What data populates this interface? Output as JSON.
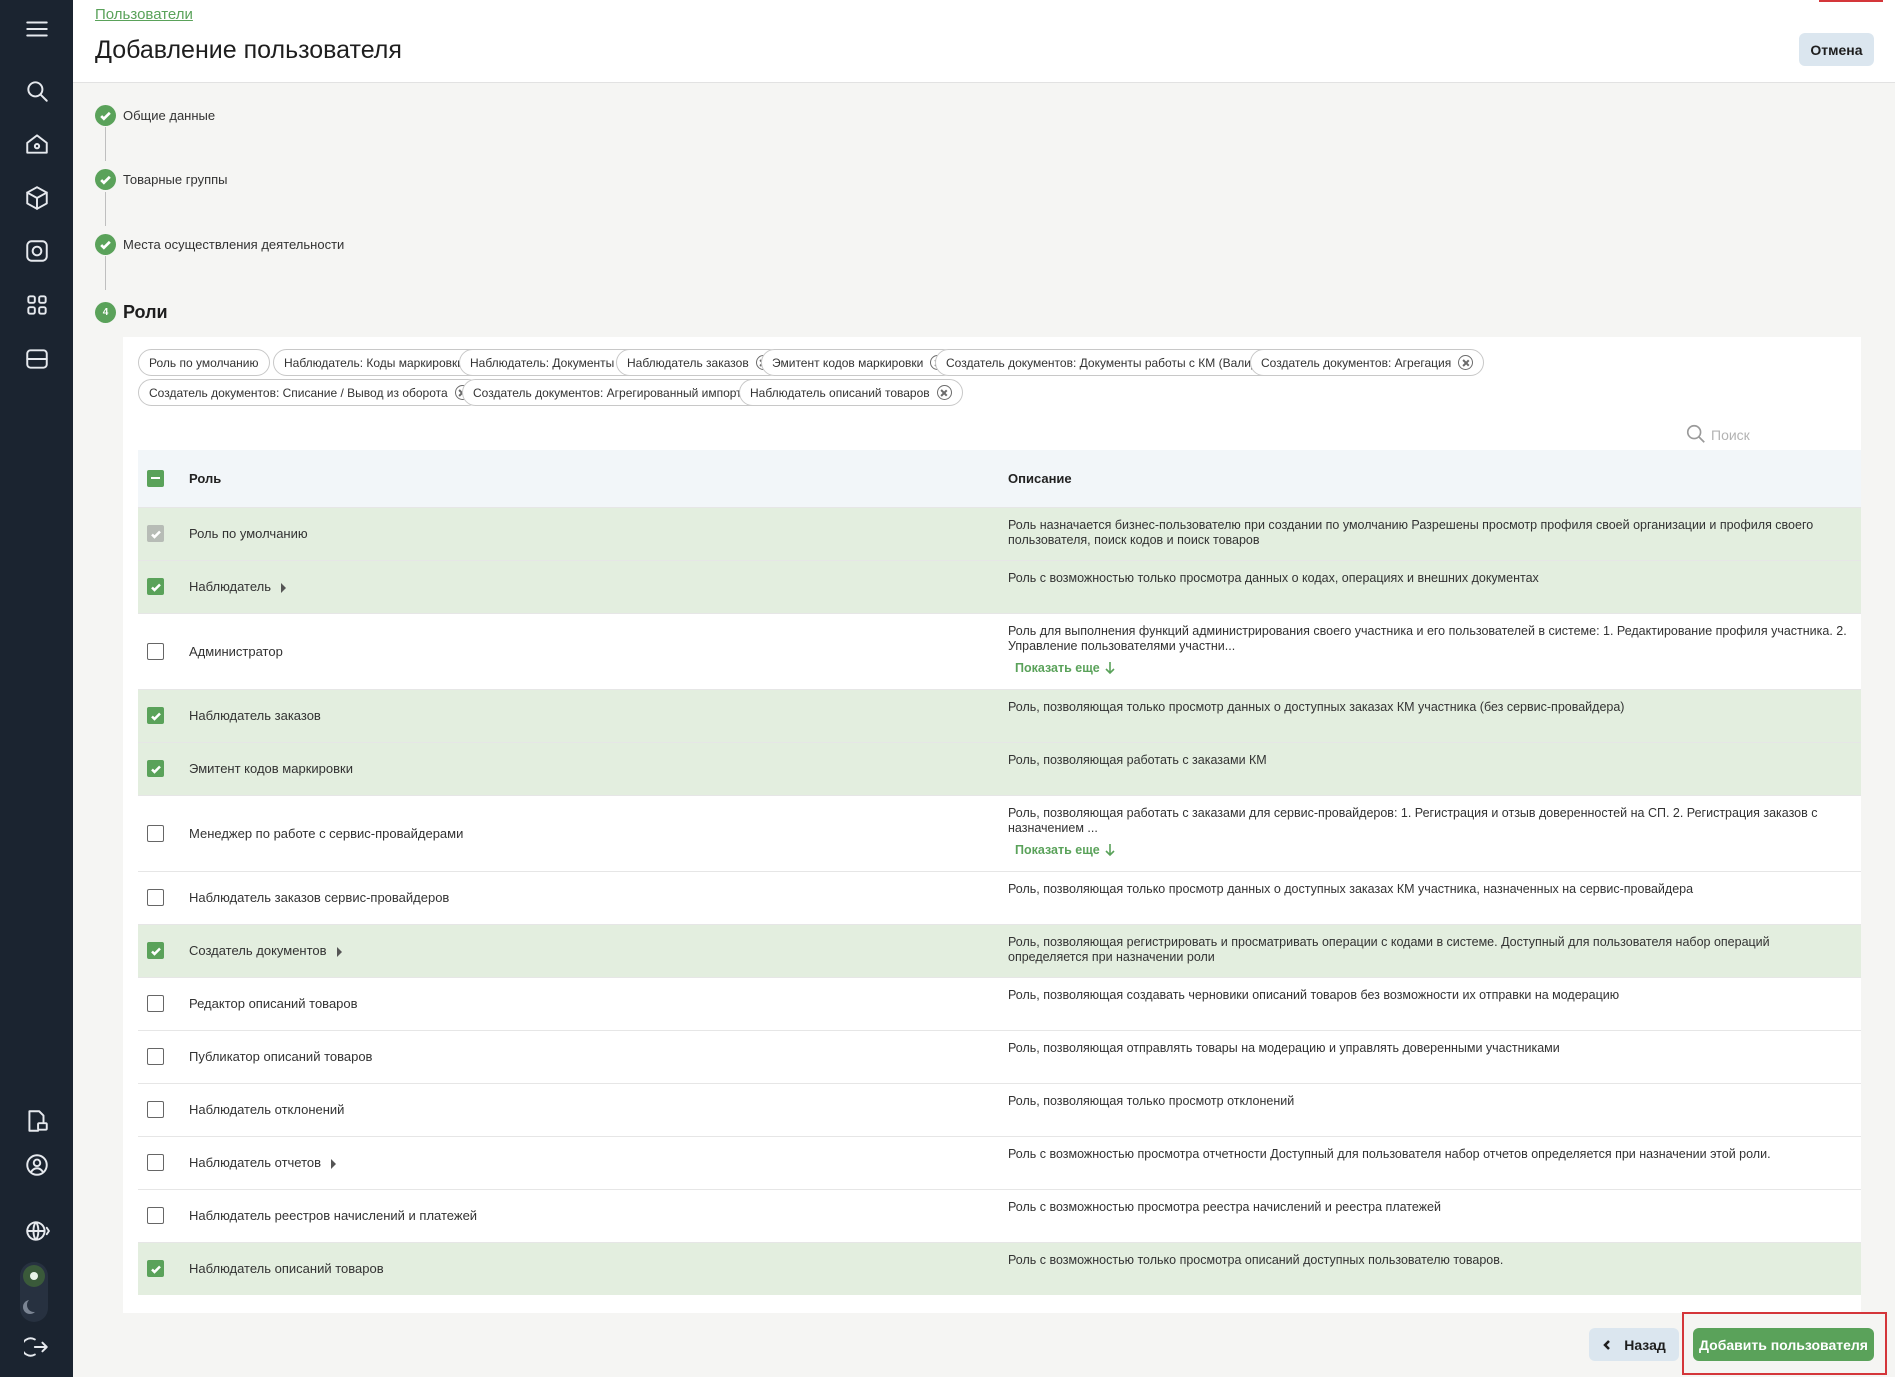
{
  "header": {
    "breadcrumb": "Пользователи",
    "title": "Добавление пользователя",
    "cancel": "Отмена"
  },
  "sidebar": {
    "icons": [
      "menu-icon",
      "search-icon",
      "home-icon",
      "cube-icon",
      "camera-box-icon",
      "qr-scan-icon",
      "storage-icon",
      "document-money-icon",
      "profile-icon",
      "globe-icon",
      "sun-icon",
      "moon-icon",
      "logout-icon"
    ]
  },
  "steps": [
    {
      "label": "Общие данные",
      "done": true
    },
    {
      "label": "Товарные группы",
      "done": true
    },
    {
      "label": "Места осуществления деятельности",
      "done": true
    },
    {
      "label": "Роли",
      "number": "4"
    }
  ],
  "chips": [
    {
      "label": "Роль по умолчанию",
      "removable": false
    },
    {
      "label": "Наблюдатель: Коды маркировки",
      "removable": true
    },
    {
      "label": "Наблюдатель: Документы",
      "removable": true
    },
    {
      "label": "Наблюдатель заказов",
      "removable": true
    },
    {
      "label": "Эмитент кодов маркировки",
      "removable": true
    },
    {
      "label": "Создатель документов: Документы работы с КМ (Валид...",
      "removable": true
    },
    {
      "label": "Создатель документов: Агрегация",
      "removable": true
    },
    {
      "label": "Создатель документов: Списание / Вывод из оборота",
      "removable": true
    },
    {
      "label": "Создатель документов: Агрегированный импортный код",
      "removable": true
    },
    {
      "label": "Наблюдатель описаний товаров",
      "removable": true
    }
  ],
  "search": {
    "placeholder": "Поиск",
    "value": ""
  },
  "table": {
    "columns": [
      "Роль",
      "Описание"
    ],
    "show_more": "Показать еще",
    "rows": [
      {
        "role": "Роль по умолчанию",
        "desc": "Роль назначается бизнес-пользователю при создании по умолчанию Разрешены просмотр профиля своей организации и профиля своего пользователя, поиск кодов и поиск товаров",
        "state": "disabled",
        "expandable": false,
        "more": false
      },
      {
        "role": "Наблюдатель",
        "desc": "Роль с возможностью только просмотра данных о кодах, операциях и внешних документах",
        "state": "checked",
        "expandable": true,
        "more": false
      },
      {
        "role": "Администратор",
        "desc": "Роль для выполнения функций администрирования своего участника и его пользователей в системе: 1. Редактирование профиля участника. 2. Управление пользователями участни...",
        "state": "unchecked",
        "expandable": false,
        "more": true
      },
      {
        "role": "Наблюдатель заказов",
        "desc": "Роль, позволяющая только просмотр данных о доступных заказах КМ участника (без сервис-провайдера)",
        "state": "checked",
        "expandable": false,
        "more": false
      },
      {
        "role": "Эмитент кодов маркировки",
        "desc": "Роль, позволяющая работать с заказами КМ",
        "state": "checked",
        "expandable": false,
        "more": false
      },
      {
        "role": "Менеджер по работе с сервис-провайдерами",
        "desc": "Роль, позволяющая работать с заказами для сервис-провайдеров: 1. Регистрация и отзыв доверенностей на СП. 2. Регистрация заказов с назначением ...",
        "state": "unchecked",
        "expandable": false,
        "more": true
      },
      {
        "role": "Наблюдатель заказов сервис-провайдеров",
        "desc": "Роль, позволяющая только просмотр данных о доступных заказах КМ участника, назначенных на сервис-провайдера",
        "state": "unchecked",
        "expandable": false,
        "more": false
      },
      {
        "role": "Создатель документов",
        "desc": "Роль, позволяющая регистрировать и просматривать операции с кодами в системе. Доступный для пользователя набор операций определяется при назначении роли",
        "state": "checked",
        "expandable": true,
        "more": false
      },
      {
        "role": "Редактор описаний товаров",
        "desc": "Роль, позволяющая создавать черновики описаний товаров без возможности их отправки на модерацию",
        "state": "unchecked",
        "expandable": false,
        "more": false
      },
      {
        "role": "Публикатор описаний товаров",
        "desc": "Роль, позволяющая отправлять товары на модерацию и управлять доверенными участниками",
        "state": "unchecked",
        "expandable": false,
        "more": false
      },
      {
        "role": "Наблюдатель отклонений",
        "desc": "Роль, позволяющая только просмотр отклонений",
        "state": "unchecked",
        "expandable": false,
        "more": false
      },
      {
        "role": "Наблюдатель отчетов",
        "desc": "Роль с возможностью просмотра отчетности Доступный для пользователя набор отчетов определяется при назначении этой роли.",
        "state": "unchecked",
        "expandable": true,
        "more": false
      },
      {
        "role": "Наблюдатель реестров начислений и платежей",
        "desc": "Роль с возможностью просмотра реестра начислений и реестра платежей",
        "state": "unchecked",
        "expandable": false,
        "more": false
      },
      {
        "role": "Наблюдатель описаний товаров",
        "desc": "Роль с возможностью только просмотра описаний доступных пользователю товаров.",
        "state": "checked",
        "expandable": false,
        "more": false
      }
    ]
  },
  "footer": {
    "back": "Назад",
    "add": "Добавить пользователя"
  },
  "colors": {
    "accent": "#5aa25a",
    "selected_row": "#e3eedf",
    "sidebar": "#1b2430",
    "highlight": "#d4363a"
  }
}
